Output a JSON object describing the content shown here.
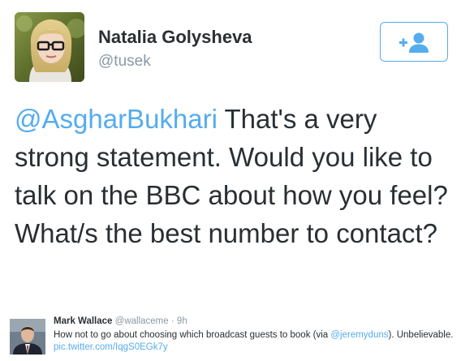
{
  "tweet": {
    "display_name": "Natalia Golysheva",
    "screen_name": "@tusek",
    "mention": "@AsgharBukhari",
    "body": " That's a very strong statement. Would you like to talk on the BBC about how you feel? What/s the best number to contact?",
    "follow_button_icon": "follow-user-icon",
    "accent_color": "#55acee"
  },
  "quoted_tweet": {
    "name": "Mark Wallace",
    "handle": "@wallaceme",
    "separator": "·",
    "time": "9h",
    "text_before": "How not to go about choosing which broadcast guests to book (via ",
    "mention": "@jeremyduns",
    "text_after": "). Unbelievable. ",
    "link": "pic.twitter.com/IqgS0EGk7y"
  }
}
